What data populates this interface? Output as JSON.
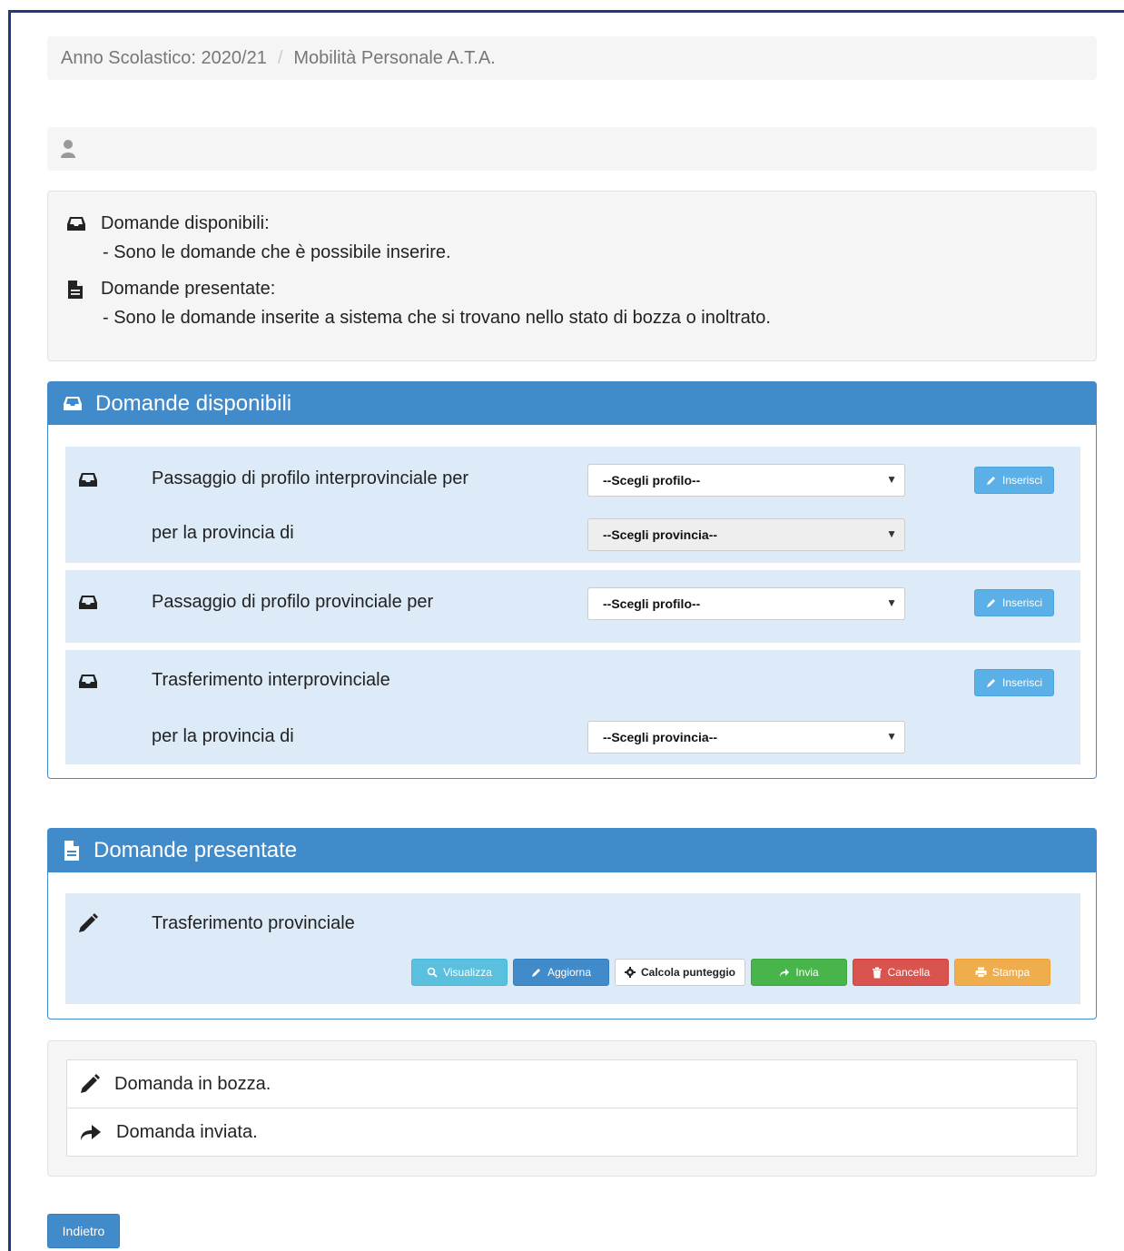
{
  "breadcrumb": {
    "year": "Anno Scolastico: 2020/21",
    "separator": "/",
    "section": "Mobilità Personale A.T.A."
  },
  "legend": {
    "available_title": "Domande disponibili:",
    "available_desc": "- Sono le domande che è possibile inserire.",
    "submitted_title": "Domande presentate:",
    "submitted_desc": "- Sono le domande inserite a sistema che si trovano nello stato di bozza o inoltrato."
  },
  "available_panel": {
    "title": "Domande disponibili",
    "rows": [
      {
        "label": "Passaggio di profilo interprovinciale per",
        "sub_label": "per la provincia di",
        "profile_select": "--Scegli profilo--",
        "province_select": "--Scegli provincia--",
        "button": "Inserisci"
      },
      {
        "label": "Passaggio di profilo provinciale per",
        "profile_select": "--Scegli profilo--",
        "button": "Inserisci"
      },
      {
        "label": "Trasferimento interprovinciale",
        "sub_label": "per la provincia di",
        "province_select": "--Scegli provincia--",
        "button": "Inserisci"
      }
    ]
  },
  "submitted_panel": {
    "title": "Domande presentate",
    "row_label": "Trasferimento provinciale",
    "buttons": {
      "view": "Visualizza",
      "update": "Aggiorna",
      "score": "Calcola punteggio",
      "send": "Invia",
      "delete": "Cancella",
      "print": "Stampa"
    }
  },
  "status_legend": {
    "draft": "Domanda in bozza.",
    "sent": "Domanda inviata."
  },
  "back_button": "Indietro",
  "colors": {
    "primary": "#428bca",
    "row_bg": "#dcebf7",
    "info": "#5bc0de",
    "success": "#47b54a",
    "danger": "#d9534f",
    "warning": "#f0ad4e"
  },
  "icons": {
    "user": "user-icon",
    "inbox": "inbox-icon",
    "file": "file-icon",
    "pencil": "pencil-icon",
    "share": "share-icon",
    "search": "search-icon",
    "gear": "gear-icon",
    "trash": "trash-icon",
    "print": "print-icon"
  }
}
